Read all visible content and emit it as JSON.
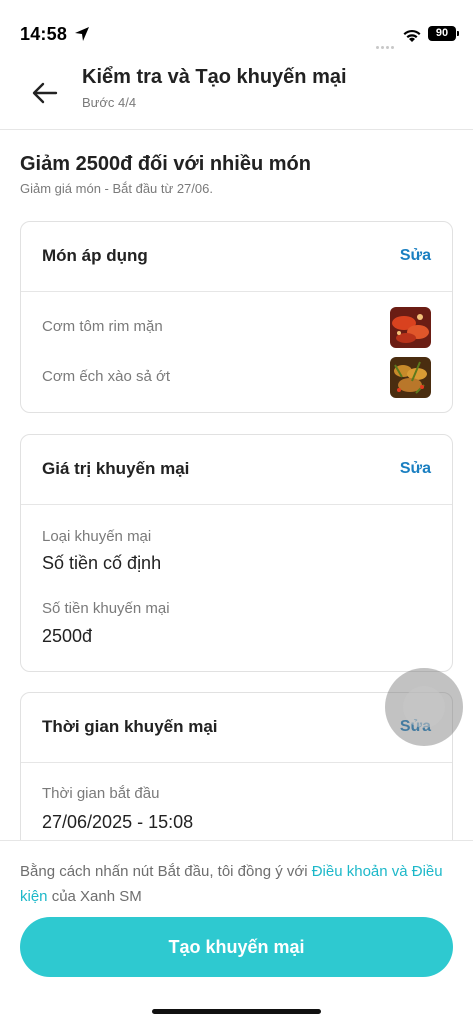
{
  "status_bar": {
    "time": "14:58",
    "battery": "90",
    "icons": [
      "location-arrow-icon",
      "signal-icon",
      "wifi-icon",
      "battery-icon"
    ]
  },
  "header": {
    "title": "Kiểm tra và Tạo khuyến mại",
    "step": "Bước 4/4",
    "back_icon": "arrow-left-icon"
  },
  "promo": {
    "title": "Giảm 2500đ đối với nhiều món",
    "subtitle": "Giảm giá món - Bắt đầu từ 27/06."
  },
  "items_card": {
    "title": "Món áp dụng",
    "edit_label": "Sửa",
    "items": [
      {
        "name": "Cơm tôm rim mặn",
        "thumb": "shrimp-dish-image"
      },
      {
        "name": "Cơm ếch xào sả ớt",
        "thumb": "frog-dish-image"
      }
    ]
  },
  "value_card": {
    "title": "Giá trị khuyến mại",
    "edit_label": "Sửa",
    "type_label": "Loại khuyến mại",
    "type_value": "Số tiền cố định",
    "amount_label": "Số tiền khuyến mại",
    "amount_value": "2500đ"
  },
  "time_card": {
    "title": "Thời gian khuyến mại",
    "edit_label": "Sửa",
    "start_label": "Thời gian bắt đầu",
    "start_value": "27/06/2025 - 15:08"
  },
  "footer": {
    "agree_prefix": "Bằng cách nhấn nút Bắt đầu, tôi đồng ý với ",
    "terms_link": "Điều khoản và Điều kiện",
    "agree_suffix": " của Xanh SM",
    "cta_label": "Tạo khuyến mại"
  },
  "colors": {
    "accent": "#2ec9d0",
    "link": "#1db8c9",
    "edit": "#1a7fc1"
  }
}
